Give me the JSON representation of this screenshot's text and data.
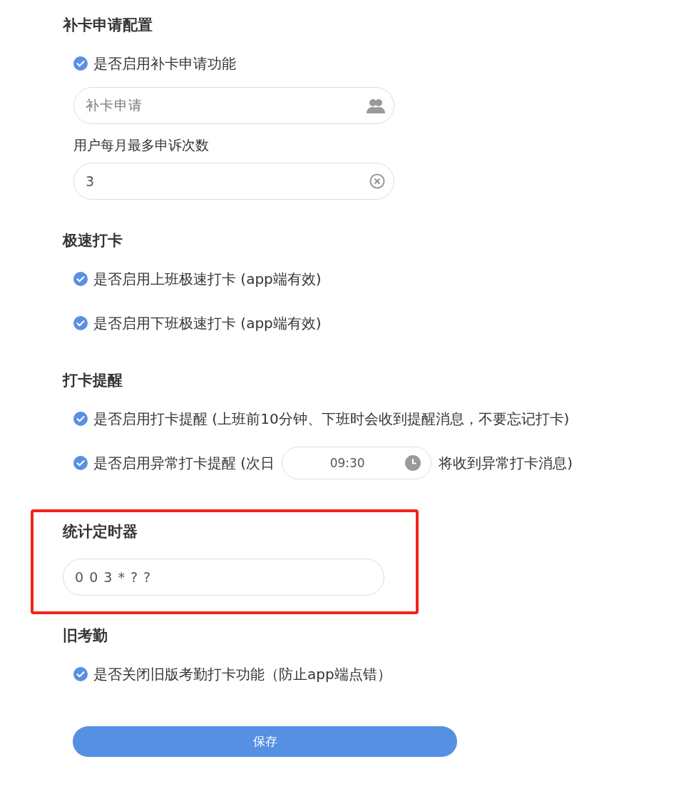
{
  "sections": [
    {
      "title": "补卡申请配置",
      "highlighted": false,
      "items": [
        {
          "kind": "checkbox",
          "label": "是否启用补卡申请功能",
          "checked": true
        },
        {
          "kind": "picker_field",
          "placeholder": "补卡申请"
        },
        {
          "kind": "label",
          "text": "用户每月最多申诉次数"
        },
        {
          "kind": "field",
          "value": "3",
          "clearable": true
        }
      ]
    },
    {
      "title": "极速打卡",
      "highlighted": false,
      "items": [
        {
          "kind": "checkbox",
          "label": "是否启用上班极速打卡 (app端有效)",
          "checked": true
        },
        {
          "kind": "checkbox",
          "label": "是否启用下班极速打卡 (app端有效)",
          "checked": true
        }
      ]
    },
    {
      "title": "打卡提醒",
      "highlighted": false,
      "items": [
        {
          "kind": "checkbox",
          "label": "是否启用打卡提醒 (上班前10分钟、下班时会收到提醒消息，不要忘记打卡)",
          "checked": true
        },
        {
          "kind": "checkbox_time",
          "label": "是否启用异常打卡提醒 (次日",
          "time": "09:30",
          "suffix": "将收到异常打卡消息)",
          "checked": true
        }
      ]
    },
    {
      "title": "统计定时器",
      "highlighted": true,
      "items": [
        {
          "kind": "field",
          "value": "0 0 3 * ? ?",
          "clearable": false
        }
      ]
    },
    {
      "title": "旧考勤",
      "highlighted": false,
      "items": [
        {
          "kind": "checkbox",
          "label": "是否关闭旧版考勤打卡功能（防止app端点错）",
          "checked": true
        }
      ]
    }
  ],
  "save_button": "保存"
}
